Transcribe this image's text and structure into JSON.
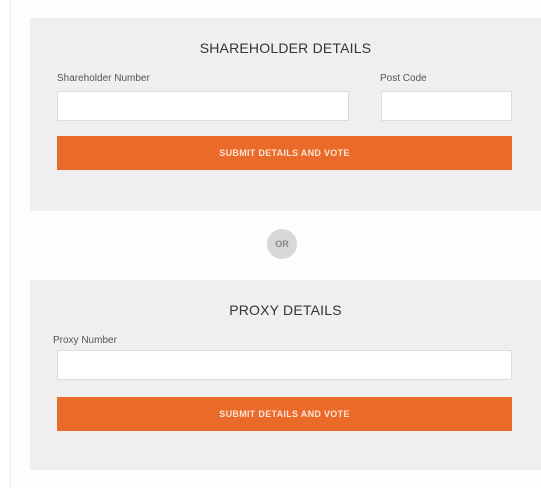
{
  "shareholder": {
    "title": "SHAREHOLDER DETAILS",
    "number_label": "Shareholder Number",
    "number_value": "",
    "postcode_label": "Post Code",
    "postcode_value": "",
    "submit_label": "SUBMIT DETAILS AND VOTE"
  },
  "divider": {
    "or_label": "OR"
  },
  "proxy": {
    "title": "PROXY DETAILS",
    "number_label": "Proxy Number",
    "number_value": "",
    "submit_label": "SUBMIT DETAILS AND VOTE"
  },
  "colors": {
    "accent": "#ea6a2a",
    "panel_bg": "#efefef",
    "or_badge": "#d8d8d8"
  }
}
